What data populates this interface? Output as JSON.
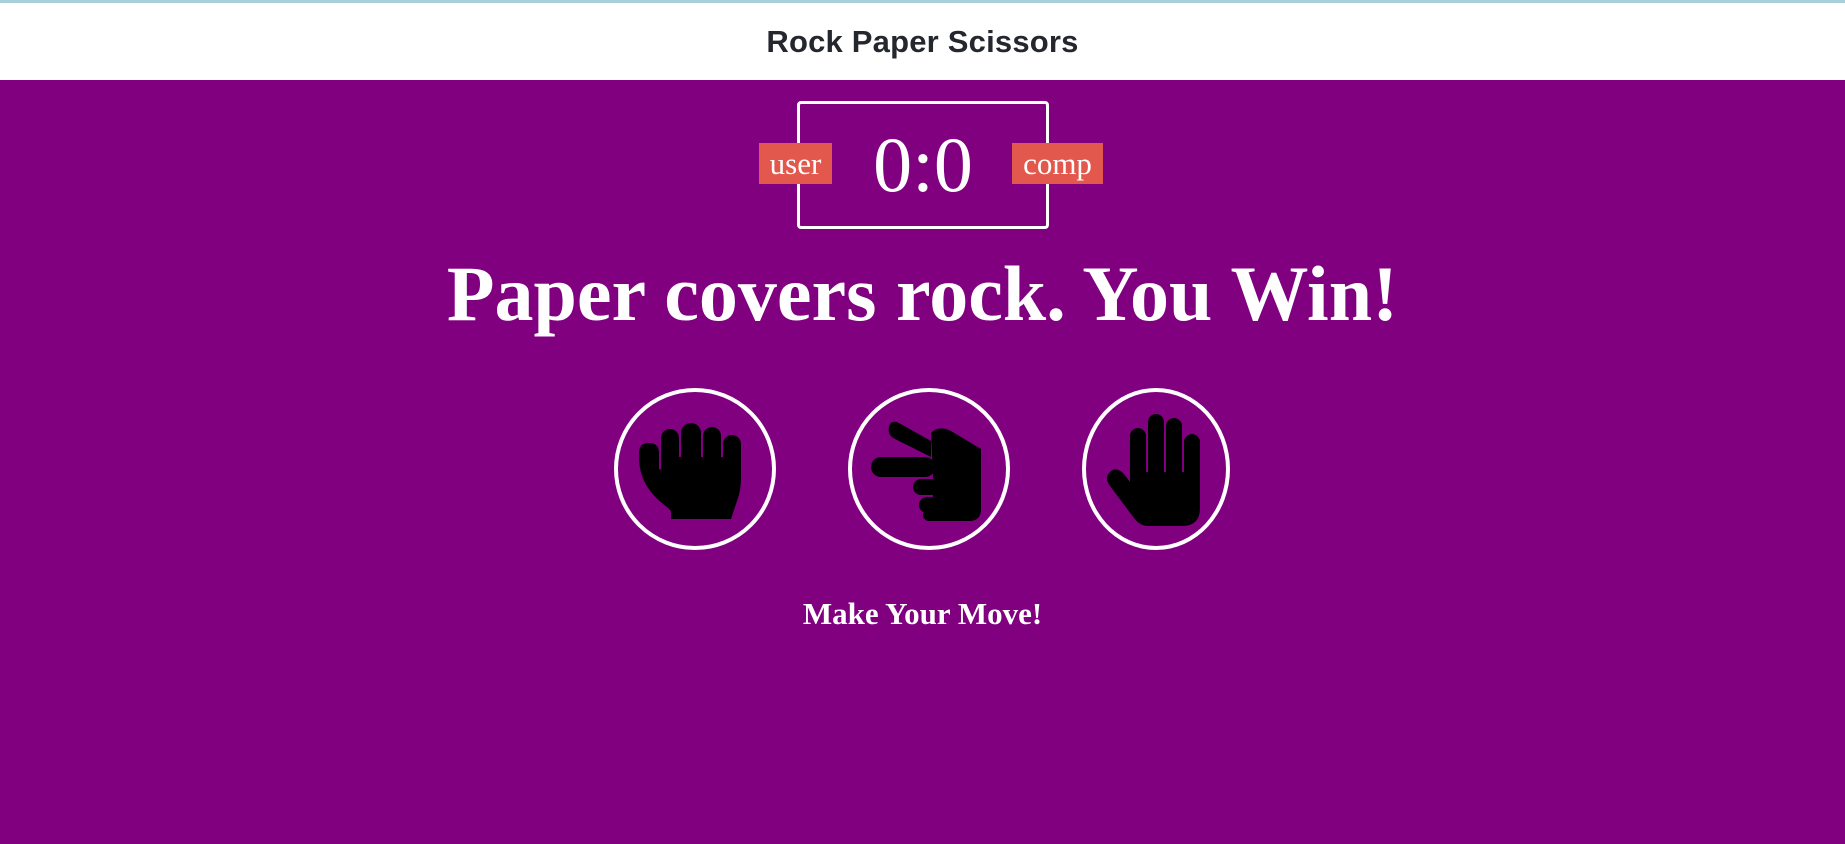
{
  "header": {
    "title": "Rock Paper Scissors"
  },
  "scoreboard": {
    "user_label": "user",
    "comp_label": "comp",
    "score_text": "0:0",
    "user_score": 0,
    "comp_score": 0
  },
  "result": {
    "message": "Paper covers rock. You Win!"
  },
  "choices": [
    {
      "id": "rock",
      "icon": "hand-rock-icon"
    },
    {
      "id": "scissors",
      "icon": "hand-scissors-icon"
    },
    {
      "id": "paper",
      "icon": "hand-paper-icon"
    }
  ],
  "prompt": {
    "text": "Make Your Move!"
  },
  "colors": {
    "background": "#800080",
    "header_bg": "#ffffff",
    "header_text": "#24272e",
    "badge": "#e2584d",
    "text": "#ffffff",
    "icon": "#000000"
  }
}
